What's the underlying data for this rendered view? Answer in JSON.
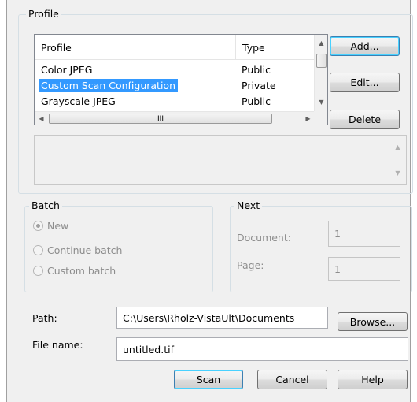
{
  "profile_group": {
    "label": "Profile",
    "columns": {
      "profile": "Profile",
      "type": "Type"
    },
    "rows": [
      {
        "name": "Color JPEG",
        "type": "Public",
        "selected": false
      },
      {
        "name": "Custom Scan Configuration",
        "type": "Private",
        "selected": true
      },
      {
        "name": "Grayscale JPEG",
        "type": "Public",
        "selected": false
      }
    ],
    "scroll_thumb_glyph": "III",
    "buttons": {
      "add": "Add...",
      "edit": "Edit...",
      "delete": "Delete"
    }
  },
  "batch_group": {
    "label": "Batch",
    "options": [
      {
        "label": "New",
        "checked": true
      },
      {
        "label": "Continue batch",
        "checked": false
      },
      {
        "label": "Custom batch",
        "checked": false
      }
    ]
  },
  "next_group": {
    "label": "Next",
    "document_label": "Document:",
    "document_value": "1",
    "page_label": "Page:",
    "page_value": "1"
  },
  "path": {
    "label": "Path:",
    "value": "C:\\Users\\Rholz-VistaUlt\\Documents",
    "browse": "Browse..."
  },
  "file_name": {
    "label": "File name:",
    "value": "untitled.tif"
  },
  "actions": {
    "scan": "Scan",
    "cancel": "Cancel",
    "help": "Help"
  },
  "colors": {
    "selection": "#3399ff",
    "dialog_bg": "#f0f0f0"
  }
}
